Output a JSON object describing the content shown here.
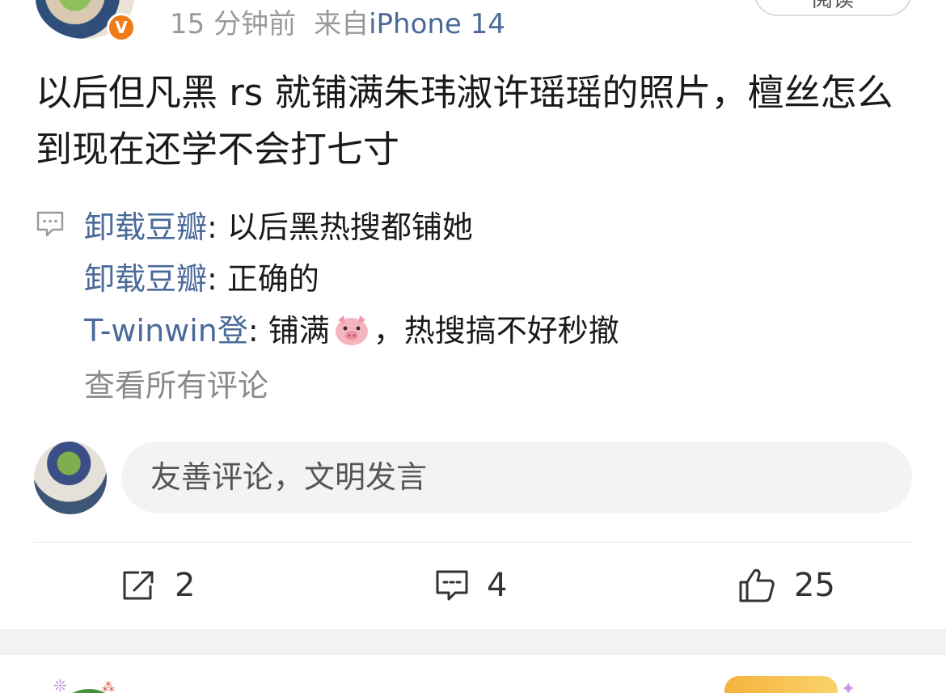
{
  "post": {
    "time": "15 分钟前",
    "source_prefix": "来自",
    "device": "iPhone 14",
    "verified_badge": "V",
    "follow_label": "阅读",
    "text": "以后但凡黑 rs 就铺满朱玮淑许瑶瑶的照片，檀丝怎么到现在还学不会打七寸"
  },
  "comments": [
    {
      "user": "卸载豆瓣",
      "sep": ": ",
      "text": "以后黑热搜都铺她"
    },
    {
      "user": "卸载豆瓣",
      "sep": ": ",
      "text": "正确的"
    },
    {
      "user": "T-winwin登",
      "sep": ": ",
      "text_before": "铺满",
      "emoji_icon": "pig-face-icon",
      "text_after": "，热搜搞不好秒撤"
    }
  ],
  "view_all_label": "查看所有评论",
  "reply": {
    "placeholder": "友善评论，文明发言"
  },
  "actions": {
    "share_count": "2",
    "comment_count": "4",
    "like_count": "25"
  },
  "icons": {
    "share": "share-icon",
    "comment": "comment-icon",
    "like": "thumbs-up-icon",
    "comment_preview": "comment-bubble-icon"
  },
  "colors": {
    "accent_link": "#4a6a9a",
    "verified": "#f07a16",
    "muted": "#9a9a9a"
  }
}
